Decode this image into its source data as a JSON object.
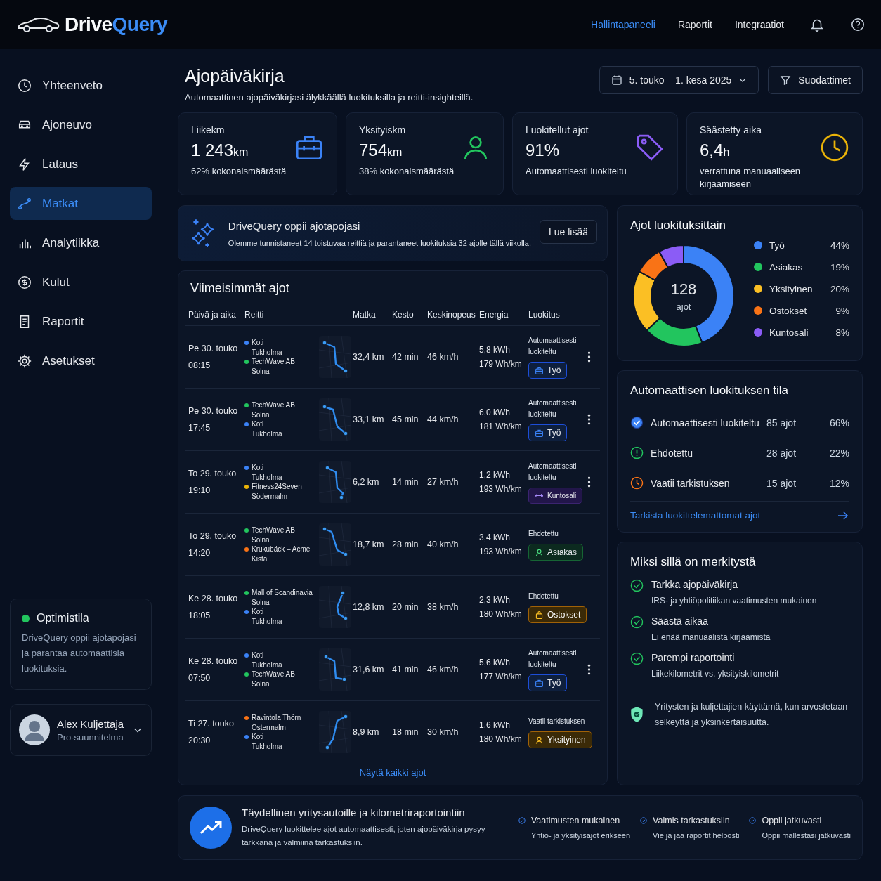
{
  "brand": {
    "part1": "Drive",
    "part2": "Query"
  },
  "nav": [
    {
      "label": "Hallintapaneeli",
      "selected": true
    },
    {
      "label": "Raportit",
      "selected": false
    },
    {
      "label": "Integraatiot",
      "selected": false
    }
  ],
  "sidebar": {
    "items": [
      {
        "label": "Yhteenveto",
        "selected": false
      },
      {
        "label": "Ajoneuvo",
        "selected": false
      },
      {
        "label": "Lataus",
        "selected": false
      },
      {
        "label": "Matkat",
        "selected": true
      },
      {
        "label": "Analytiikka",
        "selected": false
      },
      {
        "label": "Kulut",
        "selected": false
      },
      {
        "label": "Raportit",
        "selected": false
      },
      {
        "label": "Asetukset",
        "selected": false
      }
    ],
    "mode": {
      "title": "Optimistila",
      "text": "DriveQuery oppii ajotapojasi ja parantaa automaattisia luokituksia.",
      "on": true
    },
    "user": {
      "name": "Alex Kuljettaja",
      "plan": "Pro-suunnitelma"
    }
  },
  "header": {
    "title": "Ajopäiväkirja",
    "subtitle": "Automaattinen ajopäiväkirjasi älykkäällä luokituksilla ja reitti-insighteillä.",
    "date_range": "5. touko – 1. kesä 2025",
    "filter": "Suodattimet"
  },
  "stats": [
    {
      "label": "Liikekm",
      "value": "1 243",
      "unit": "km",
      "note": "62% kokonaismäärästä",
      "color": "#3b82f6"
    },
    {
      "label": "Yksityiskm",
      "value": "754",
      "unit": "km",
      "note": "38% kokonaismäärästä",
      "color": "#22c55e"
    },
    {
      "label": "Luokitellut ajot",
      "value": "91%",
      "note": "Automaattisesti luokiteltu",
      "color": "#8b5cf6"
    },
    {
      "label": "Säästetty aika",
      "value": "6,4",
      "unit": "h",
      "note": "verrattuna manuaaliseen kirjaamiseen",
      "color": "#eab308"
    }
  ],
  "insight": {
    "title": "DriveQuery oppii ajotapojasi",
    "text": "Olemme tunnistaneet 14 toistuvaa reittiä ja parantaneet luokituksia 32 ajolle tällä viikolla.",
    "button": "Lue lisää"
  },
  "trips": {
    "title": "Viimeisimmät ajot",
    "columns": [
      "Päivä ja aika",
      "Reitti",
      "Matka",
      "Kesto",
      "Keskinopeus",
      "Energia",
      "Luokitus"
    ],
    "rows": [
      {
        "date": "Pe 30. touko",
        "time": "08:15",
        "stops": [
          {
            "name": "Koti",
            "area": "Tukholma",
            "color": "#3b82f6"
          },
          {
            "name": "TechWave AB",
            "area": "Solna",
            "color": "#22c55e"
          }
        ],
        "distance": "32,4 km",
        "duration": "42 min",
        "speed": "46 km/h",
        "energy": "5,8 kWh",
        "efficiency": "179 Wh/km",
        "status": "Automaattisesti luokiteltu",
        "kind": "work",
        "category": "Työ",
        "menu": true
      },
      {
        "date": "Pe 30. touko",
        "time": "17:45",
        "stops": [
          {
            "name": "TechWave AB",
            "area": "Solna",
            "color": "#22c55e"
          },
          {
            "name": "Koti",
            "area": "Tukholma",
            "color": "#3b82f6"
          }
        ],
        "distance": "33,1 km",
        "duration": "45 min",
        "speed": "44 km/h",
        "energy": "6,0 kWh",
        "efficiency": "181 Wh/km",
        "status": "Automaattisesti luokiteltu",
        "kind": "work",
        "category": "Työ",
        "menu": true
      },
      {
        "date": "To 29. touko",
        "time": "19:10",
        "stops": [
          {
            "name": "Koti",
            "area": "Tukholma",
            "color": "#3b82f6"
          },
          {
            "name": "Fitness24Seven",
            "area": "Södermalm",
            "color": "#eab308"
          }
        ],
        "distance": "6,2 km",
        "duration": "14 min",
        "speed": "27 km/h",
        "energy": "1,2 kWh",
        "efficiency": "193 Wh/km",
        "status": "Automaattisesti luokiteltu",
        "kind": "gym",
        "category": "Kuntosali",
        "menu": true
      },
      {
        "date": "To 29. touko",
        "time": "14:20",
        "stops": [
          {
            "name": "TechWave AB",
            "area": "Solna",
            "color": "#22c55e"
          },
          {
            "name": "Krukubäck – Acme",
            "area": "Kista",
            "color": "#f97316"
          }
        ],
        "distance": "18,7 km",
        "duration": "28 min",
        "speed": "40 km/h",
        "energy": "3,4 kWh",
        "efficiency": "193 Wh/km",
        "status": "Ehdotettu",
        "kind": "client",
        "category": "Asiakas",
        "menu": false
      },
      {
        "date": "Ke 28. touko",
        "time": "18:05",
        "stops": [
          {
            "name": "Mall of Scandinavia",
            "area": "Solna",
            "color": "#22c55e"
          },
          {
            "name": "Koti",
            "area": "Tukholma",
            "color": "#3b82f6"
          }
        ],
        "distance": "12,8 km",
        "duration": "20 min",
        "speed": "38 km/h",
        "energy": "2,3 kWh",
        "efficiency": "180 Wh/km",
        "status": "Ehdotettu",
        "kind": "shopping",
        "category": "Ostokset",
        "menu": false
      },
      {
        "date": "Ke 28. touko",
        "time": "07:50",
        "stops": [
          {
            "name": "Koti",
            "area": "Tukholma",
            "color": "#3b82f6"
          },
          {
            "name": "TechWave AB",
            "area": "Solna",
            "color": "#22c55e"
          }
        ],
        "distance": "31,6 km",
        "duration": "41 min",
        "speed": "46 km/h",
        "energy": "5,6 kWh",
        "efficiency": "177 Wh/km",
        "status": "Automaattisesti luokiteltu",
        "kind": "work",
        "category": "Työ",
        "menu": true
      },
      {
        "date": "Ti 27. touko",
        "time": "20:30",
        "stops": [
          {
            "name": "Ravintola Thörn",
            "area": "Östermalm",
            "color": "#f97316"
          },
          {
            "name": "Koti",
            "area": "Tukholma",
            "color": "#3b82f6"
          }
        ],
        "distance": "8,9 km",
        "duration": "18 min",
        "speed": "30 km/h",
        "energy": "1,6 kWh",
        "efficiency": "180 Wh/km",
        "status": "Vaatii tarkistuksen",
        "kind": "private",
        "category": "Yksityinen",
        "menu": false
      }
    ],
    "show_all": "Näytä kaikki ajot"
  },
  "breakdown": {
    "title": "Ajot luokituksittain",
    "total": "128",
    "total_label": "ajot",
    "chart_data": {
      "type": "donut",
      "categories": [
        "Työ",
        "Asiakas",
        "Yksityinen",
        "Ostokset",
        "Kuntosali"
      ],
      "values": [
        44,
        19,
        20,
        9,
        8
      ]
    },
    "legend": [
      {
        "percent": "44%",
        "color": "#3b82f6"
      },
      {
        "percent": "19%",
        "color": "#22c55e"
      },
      {
        "percent": "20%",
        "color": "#fbbf24"
      },
      {
        "percent": "9%",
        "color": "#f97316"
      },
      {
        "percent": "8%",
        "color": "#8b5cf6"
      }
    ]
  },
  "auto_status": {
    "title": "Automaattisen luokituksen tila",
    "items": [
      {
        "kind": "auto",
        "label": "Automaattisesti luokiteltu",
        "count": "85 ajot",
        "percent": "66%"
      },
      {
        "kind": "suggested",
        "label": "Ehdotettu",
        "count": "28 ajot",
        "percent": "22%"
      },
      {
        "kind": "review",
        "label": "Vaatii tarkistuksen",
        "count": "15 ajot",
        "percent": "12%"
      }
    ],
    "link": "Tarkista luokittelemattomat ajot"
  },
  "why": {
    "title": "Miksi sillä on merkitystä",
    "items": [
      {
        "title": "Tarkka ajopäiväkirja",
        "text": "IRS- ja yhtiöpolitiikan vaatimusten mukainen"
      },
      {
        "title": "Säästä aikaa",
        "text": "Ei enää manuaalista kirjaamista"
      },
      {
        "title": "Parempi raportointi",
        "text": "Liikekilometrit vs. yksityiskilometrit"
      }
    ],
    "trust": "Yritysten ja kuljettajien käyttämä, kun arvostetaan selkeyttä ja yksinkertaisuutta."
  },
  "footer": {
    "title": "Täydellinen yritysautoille ja kilometriraportointiin",
    "text": "DriveQuery luokittelee ajot automaattisesti, joten ajopäiväkirja pysyy tarkkana ja valmiina tarkastuksiin.",
    "features": [
      {
        "title": "Vaatimusten mukainen",
        "text": "Yhtiö- ja yksityisajot erikseen"
      },
      {
        "title": "Valmis tarkastuksiin",
        "text": "Vie ja jaa raportit helposti"
      },
      {
        "title": "Oppii jatkuvasti",
        "text": "Oppii mallestasi jatkuvasti"
      }
    ]
  }
}
